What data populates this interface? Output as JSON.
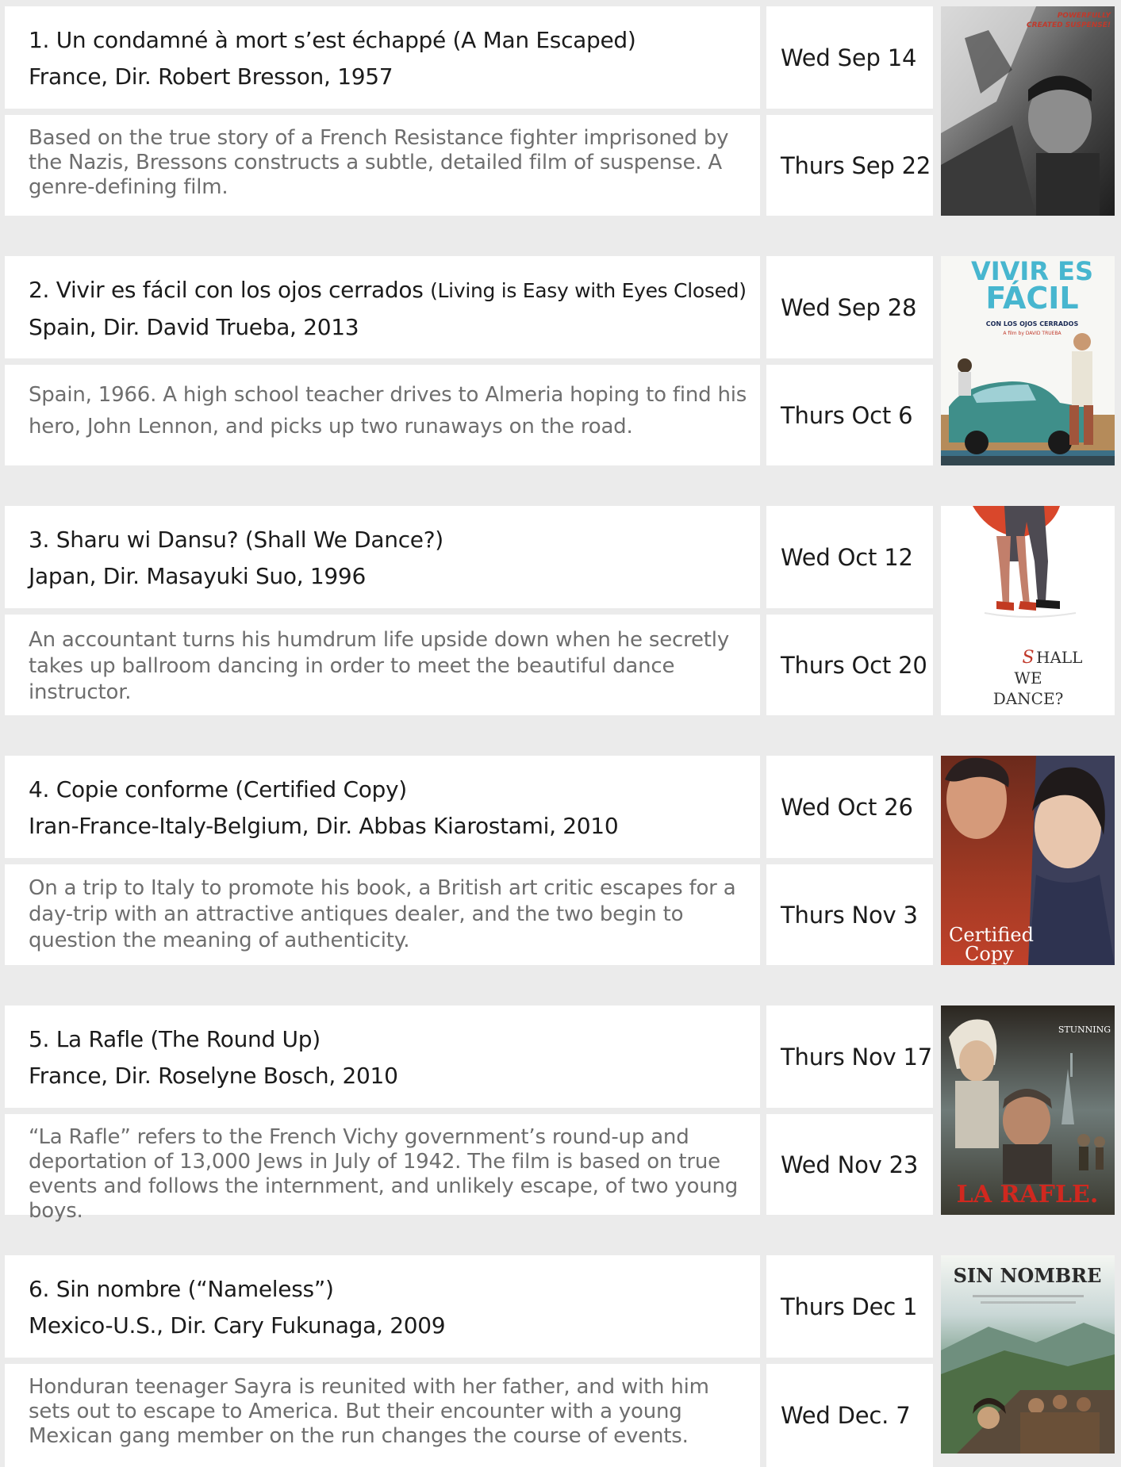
{
  "films": [
    {
      "number_title": "1. Un condamné à mort s’est échappé (A Man Escaped)",
      "title_en": "",
      "meta": "France, Dir. Robert Bresson, 1957",
      "description": "Based on the true story of a French Resistance fighter imprisoned by the Nazis, Bressons constructs a subtle, detailed film of suspense. A genre-defining film.",
      "dates": [
        "Wed Sep 14",
        "Thurs Sep 22"
      ],
      "poster": {
        "subject": "A Man Escaped poster",
        "lettering": "POWERFULLY CREATED SUSPENSE!"
      }
    },
    {
      "number_title": "2. Vivir es fácil con los ojos cerrados",
      "title_en": "(Living is Easy with Eyes Closed)",
      "meta": "Spain, Dir. David Trueba, 2013",
      "description": "Spain, 1966. A high school teacher drives to Almeria hoping to find his hero, John Lennon, and picks up two runaways on the road.",
      "dates": [
        "Wed Sep 28",
        "Thurs Oct 6"
      ],
      "poster": {
        "subject": "Vivir es fácil poster",
        "lettering": "VIVIR ES FÁCIL — CON LOS OJOS CERRADOS — A film by DAVID TRUEBA"
      }
    },
    {
      "number_title": "3. Sharu wi Dansu? (Shall We Dance?)",
      "title_en": "",
      "meta": "Japan, Dir. Masayuki Suo, 1996",
      "description": "An accountant turns his humdrum life upside down when he secretly takes up ballroom dancing in order to meet the beautiful dance instructor.",
      "dates": [
        "Wed Oct 12",
        "Thurs Oct 20"
      ],
      "poster": {
        "subject": "Shall We Dance poster",
        "lettering": "SHALL WE DANCE?"
      }
    },
    {
      "number_title": "4. Copie conforme (Certified Copy)",
      "title_en": "",
      "meta": "Iran-France-Italy-Belgium, Dir. Abbas Kiarostami, 2010",
      "description": "On a trip to Italy to promote his book, a British art critic escapes for a day-trip with an attractive antiques dealer, and the two begin to question the meaning of authenticity.",
      "dates": [
        "Wed Oct 26",
        "Thurs Nov 3"
      ],
      "poster": {
        "subject": "Certified Copy poster",
        "lettering": "Certified Copy"
      }
    },
    {
      "number_title": "5. La Rafle (The Round Up)",
      "title_en": "",
      "meta": "France, Dir. Roselyne Bosch, 2010",
      "description": "“La Rafle” refers to the French Vichy government’s round-up and deportation of 13,000 Jews in July of 1942. The film is based on true events and follows the internment, and unlikely escape, of two young boys.",
      "dates": [
        "Thurs Nov 17",
        "Wed Nov 23"
      ],
      "poster": {
        "subject": "La Rafle poster",
        "lettering": "LA RAFLE. — STUNNING"
      }
    },
    {
      "number_title": "6. Sin nombre (“Nameless”)",
      "title_en": "",
      "meta": "Mexico-U.S., Dir. Cary Fukunaga, 2009",
      "description": "Honduran teenager Sayra is reunited with her father, and with him sets out to escape to America. But their encounter with a young Mexican gang member on the run changes the course of events.",
      "dates": [
        "Thurs Dec 1",
        "Wed Dec. 7"
      ],
      "poster": {
        "subject": "Sin Nombre poster",
        "lettering": "SIN NOMBRE"
      }
    }
  ]
}
